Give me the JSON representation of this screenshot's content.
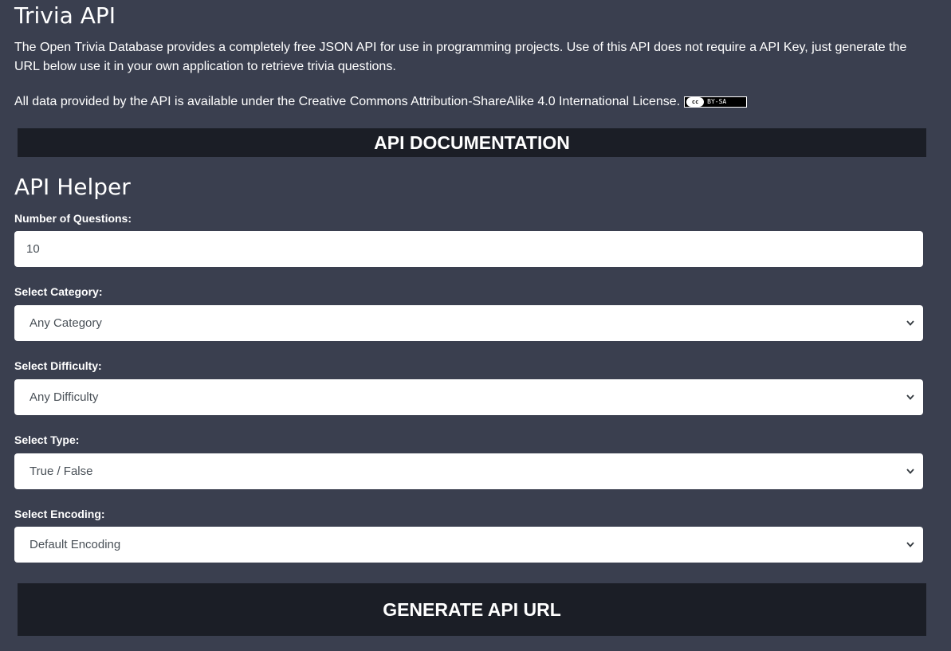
{
  "header": {
    "title": "Trivia API",
    "intro": "The Open Trivia Database provides a completely free JSON API for use in programming projects. Use of this API does not require a API Key, just generate the URL below use it in your own application to retrieve trivia questions.",
    "license_text": "All data provided by the API is available under the Creative Commons Attribution-ShareAlike 4.0 International License.",
    "license_badge_cc": "cc",
    "license_badge_text": "BY-SA"
  },
  "documentation_button": {
    "label": "API DOCUMENTATION"
  },
  "helper": {
    "title": "API Helper",
    "fields": {
      "amount": {
        "label": "Number of Questions:",
        "value": "10"
      },
      "category": {
        "label": "Select Category:",
        "value": "Any Category"
      },
      "difficulty": {
        "label": "Select Difficulty:",
        "value": "Any Difficulty"
      },
      "type": {
        "label": "Select Type:",
        "value": "True / False"
      },
      "encoding": {
        "label": "Select Encoding:",
        "value": "Default Encoding"
      }
    },
    "generate_button": {
      "label": "GENERATE API URL"
    }
  },
  "icons": {
    "select_arrow": "chevron-down-icon",
    "license_badge": "cc-by-sa-icon"
  },
  "colors": {
    "background": "#3a3f4f",
    "bar": "#1b1e26",
    "field": "#ffffff",
    "field_text": "#495057"
  }
}
